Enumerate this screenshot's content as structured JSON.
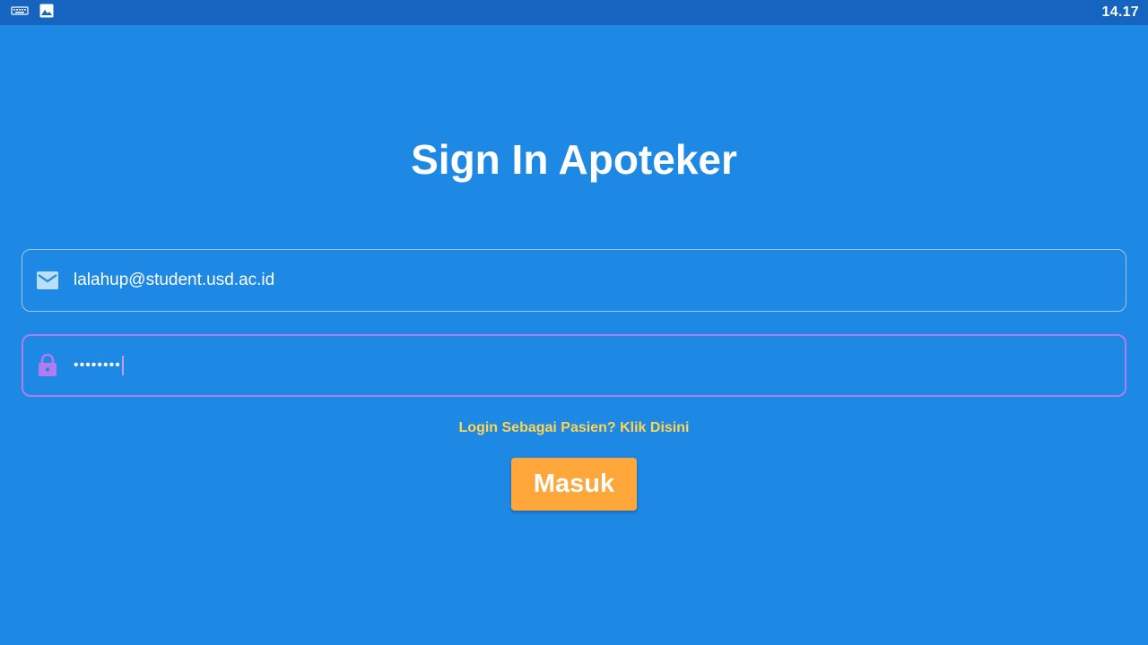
{
  "status_bar": {
    "time": "14.17",
    "icons": [
      "keyboard-icon",
      "image-icon"
    ]
  },
  "title": "Sign In Apoteker",
  "email_field": {
    "icon": "mail-icon",
    "value": "lalahup@student.usd.ac.id"
  },
  "password_field": {
    "icon": "lock-icon",
    "value": "••••••••"
  },
  "patient_login_link": "Login Sebagai Pasien? Klik Disini",
  "submit_button": "Masuk",
  "colors": {
    "background": "#1e88e5",
    "status_bar": "#1565c0",
    "focus_border": "#b07cf0",
    "link": "#ffd54f",
    "button": "#ffa73a"
  }
}
